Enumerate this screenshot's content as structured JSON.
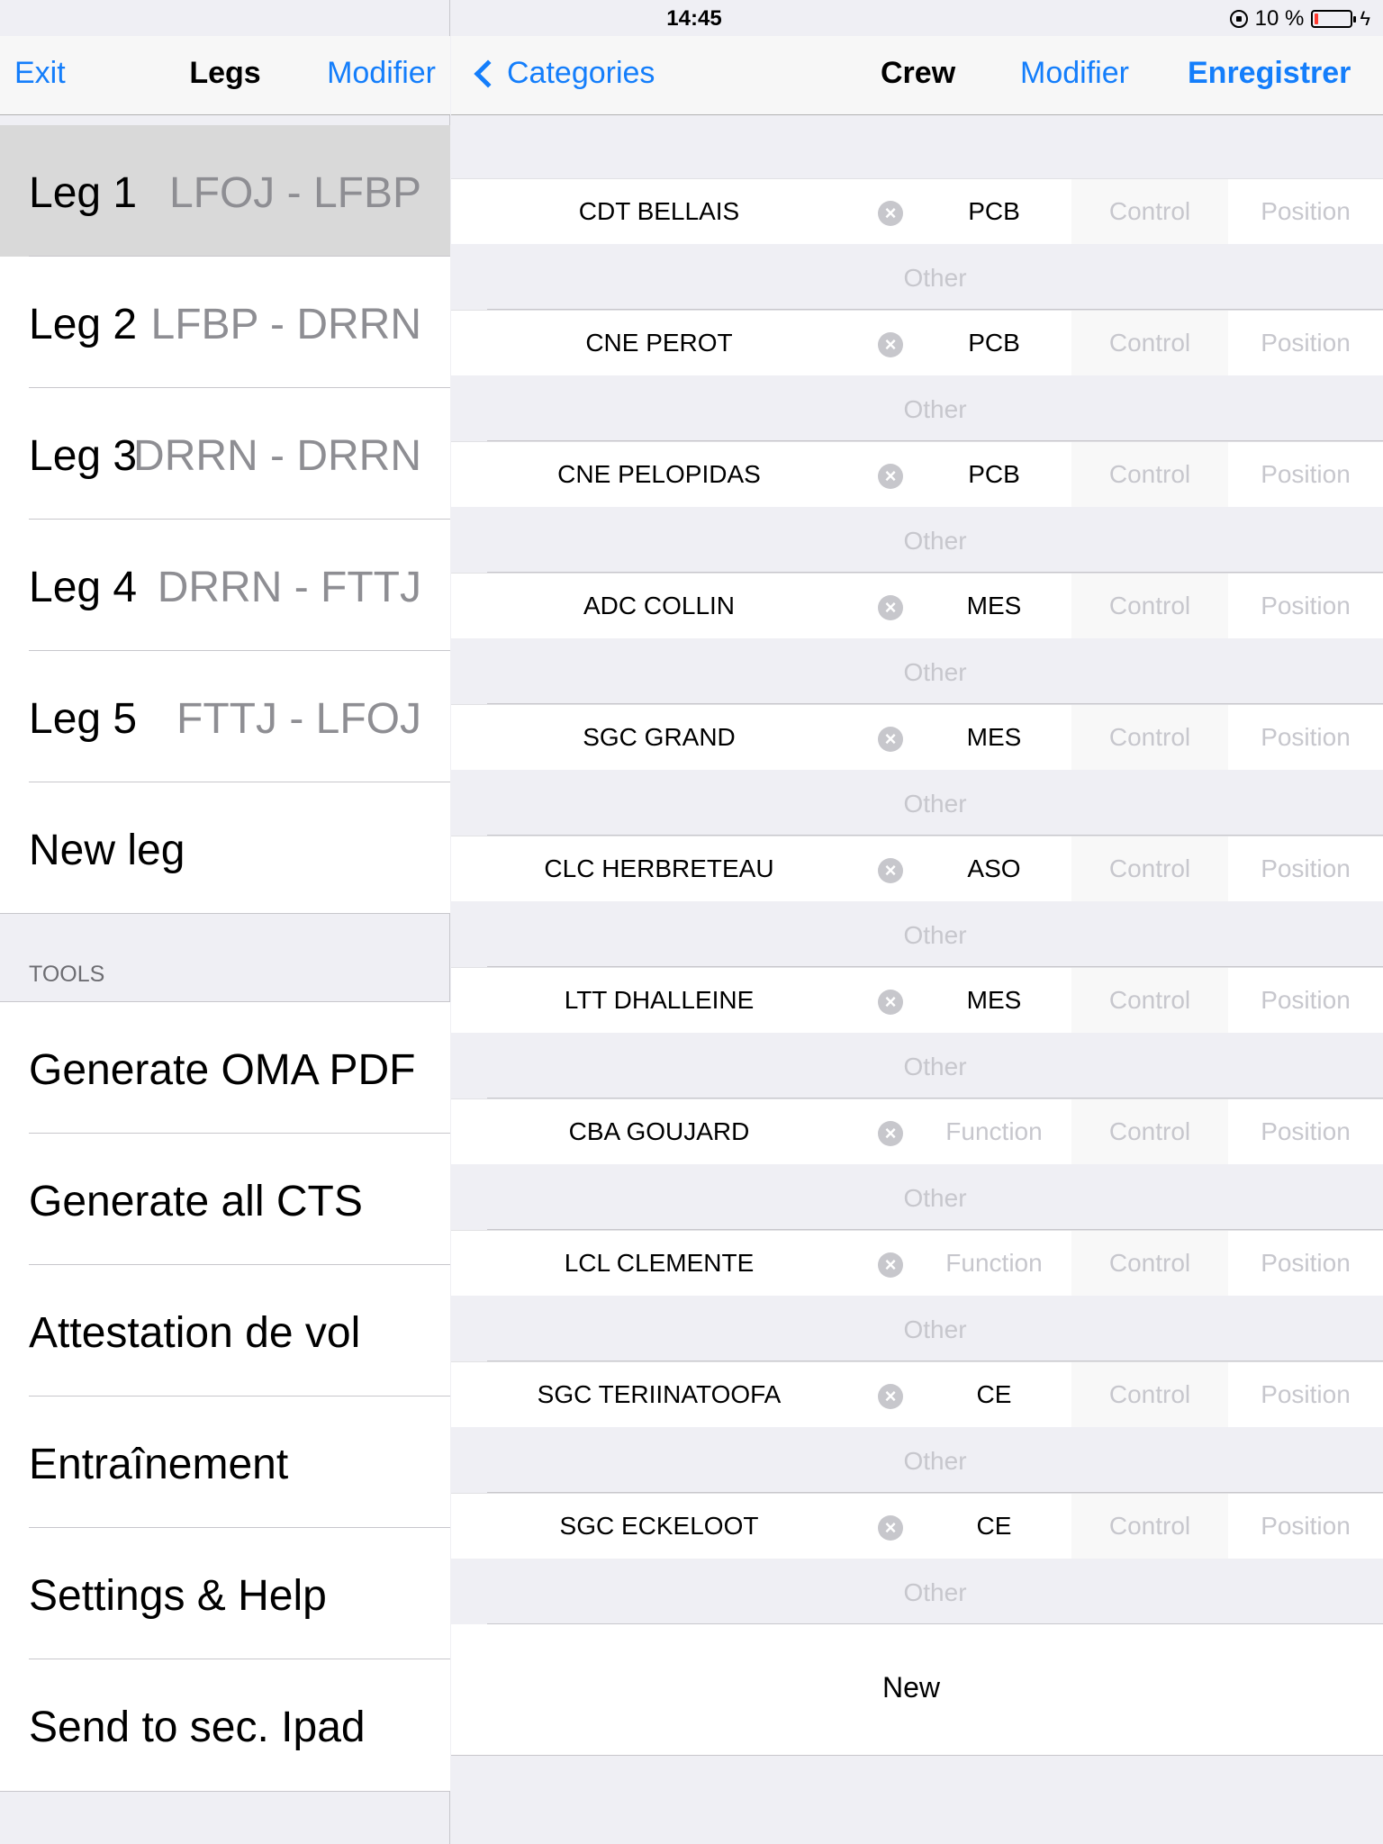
{
  "status_bar": {
    "time": "14:45",
    "battery": "10 %",
    "battery_level": 0.1
  },
  "left_nav": {
    "left": "Exit",
    "title": "Legs",
    "right": "Modifier"
  },
  "legs": [
    {
      "name": "Leg 1",
      "route": "LFOJ - LFBP",
      "selected": true
    },
    {
      "name": "Leg 2",
      "route": "LFBP - DRRN",
      "selected": false
    },
    {
      "name": "Leg 3",
      "route": "DRRN - DRRN",
      "selected": false
    },
    {
      "name": "Leg 4",
      "route": "DRRN - FTTJ",
      "selected": false
    },
    {
      "name": "Leg 5",
      "route": "FTTJ - LFOJ",
      "selected": false
    }
  ],
  "new_leg": "New leg",
  "tools_header": "TOOLS",
  "tools": [
    "Generate OMA PDF",
    "Generate all CTS",
    "Attestation de vol",
    "Entraînement",
    "Settings & Help",
    "Send to sec. Ipad"
  ],
  "right_nav": {
    "back": "Categories",
    "title": "Crew",
    "modifier": "Modifier",
    "save": "Enregistrer"
  },
  "placeholders": {
    "function": "Function",
    "control": "Control",
    "position": "Position",
    "other": "Other"
  },
  "crew": [
    {
      "name": "CDT BELLAIS",
      "function": "PCB"
    },
    {
      "name": "CNE PEROT",
      "function": "PCB"
    },
    {
      "name": "CNE PELOPIDAS",
      "function": "PCB"
    },
    {
      "name": "ADC COLLIN",
      "function": "MES"
    },
    {
      "name": "SGC GRAND",
      "function": "MES"
    },
    {
      "name": "CLC HERBRETEAU",
      "function": "ASO"
    },
    {
      "name": "LTT DHALLEINE",
      "function": "MES"
    },
    {
      "name": "CBA GOUJARD",
      "function": ""
    },
    {
      "name": "LCL CLEMENTE",
      "function": ""
    },
    {
      "name": "SGC TERIINATOOFA",
      "function": "CE"
    },
    {
      "name": "SGC ECKELOOT",
      "function": "CE"
    }
  ],
  "new_crew": "New",
  "colors": {
    "accent": "#147efb",
    "placeholder": "#c7c7cd",
    "background": "#efeff4",
    "selected": "#d9d9d9"
  }
}
